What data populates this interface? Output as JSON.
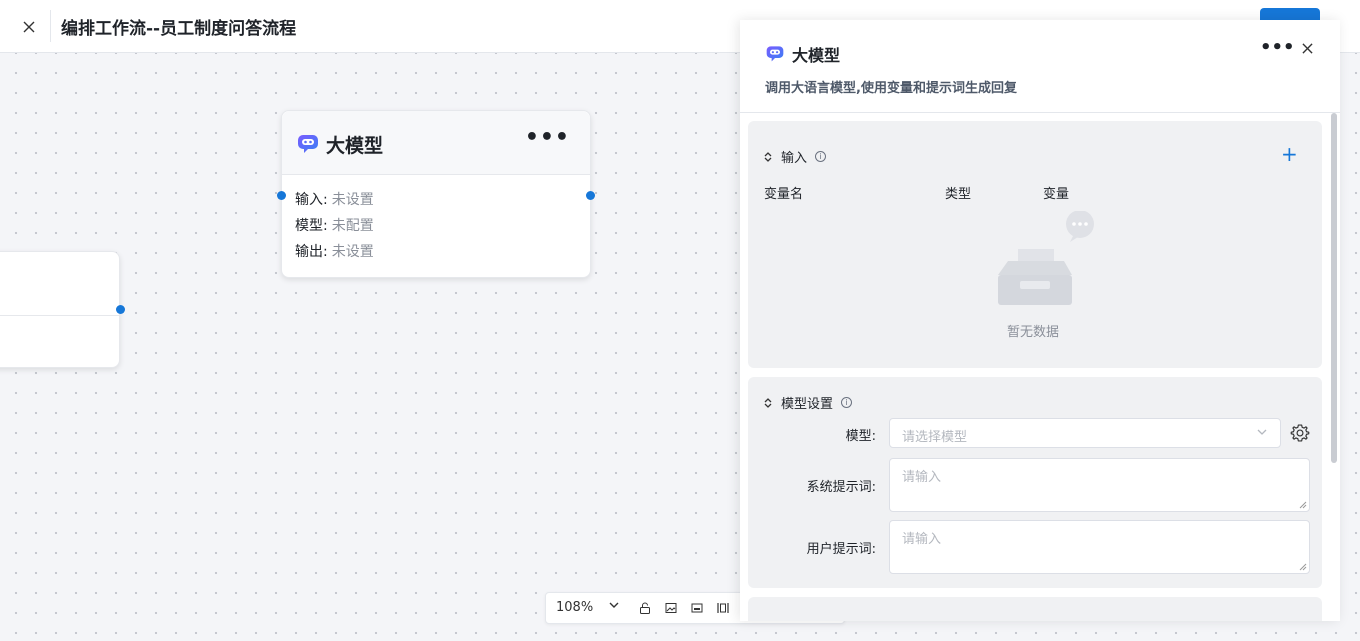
{
  "header": {
    "title": "编排工作流--员工制度问答流程",
    "action_label": ""
  },
  "canvas": {
    "llm_node": {
      "title": "大模型",
      "more": "•••",
      "rows": [
        {
          "label": "输入:",
          "value": "未设置"
        },
        {
          "label": "模型:",
          "value": "未配置"
        },
        {
          "label": "输出:",
          "value": "未设置"
        }
      ]
    },
    "toolbar": {
      "zoom": "108%"
    }
  },
  "panel": {
    "title": "大模型",
    "more": "•••",
    "description": "调用大语言模型,使用变量和提示词生成回复",
    "input_section": {
      "title": "输入",
      "add": "+",
      "columns": [
        "变量名",
        "类型",
        "变量"
      ],
      "empty_text": "暂无数据"
    },
    "model_section": {
      "title": "模型设置",
      "model_label": "模型:",
      "model_placeholder": "请选择模型",
      "system_prompt_label": "系统提示词:",
      "system_prompt_placeholder": "请输入",
      "user_prompt_label": "用户提示词:",
      "user_prompt_placeholder": "请输入"
    }
  }
}
